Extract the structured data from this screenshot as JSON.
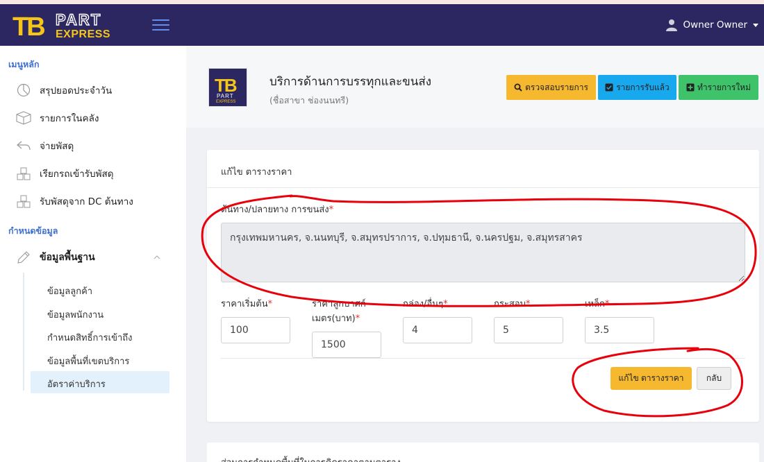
{
  "brand": {
    "logo_top": "PART",
    "logo_bottom": "EXPRESS",
    "logo_mark": "TB"
  },
  "user": {
    "name": "Owner Owner",
    "icon": "user-icon"
  },
  "sidebar": {
    "section_main": "เมนูหลัก",
    "main_items": [
      {
        "label": "สรุปยอดประจำวัน",
        "icon": "pie-chart-icon"
      },
      {
        "label": "รายการในคลัง",
        "icon": "box-icon"
      },
      {
        "label": "จ่ายพัสดุ",
        "icon": "reply-arrow-icon"
      },
      {
        "label": "เรียกรถเข้ารับพัสดุ",
        "icon": "boxes-icon"
      },
      {
        "label": "รับพัสดุจาก DC ต้นทาง",
        "icon": "boxes-icon"
      }
    ],
    "section_settings": "กำหนดข้อมูล",
    "settings_group": {
      "label": "ข้อมูลพื้นฐาน",
      "icon": "pencil-icon"
    },
    "sub_items": [
      {
        "label": "ข้อมูลลูกค้า"
      },
      {
        "label": "ข้อมูลพนักงาน"
      },
      {
        "label": "กำหนดสิทธิ์การเข้าถึง"
      },
      {
        "label": "ข้อมูลพื้นที่เขตบริการ"
      },
      {
        "label": "อัตราค่าบริการ"
      }
    ],
    "active_sub": "อัตราค่าบริการ"
  },
  "header": {
    "title": "บริการด้านการบรรทุกและขนส่ง",
    "subtitle": "(ชื่อสาขา ช่องนนทรี)",
    "buttons": [
      {
        "label": "ตรวจสอบรายการ",
        "icon": "search-icon",
        "color": "#f5b82e"
      },
      {
        "label": "รายการรับแล้ว",
        "icon": "checkbox-icon",
        "color": "#18a8ee"
      },
      {
        "label": "ทำรายการใหม่",
        "icon": "plus-square-icon",
        "color": "#3ec36a"
      }
    ]
  },
  "form": {
    "card_title": "แก้ไข ตารางราคา",
    "route_label": "ต้นทาง/ปลายทาง การขนส่ง",
    "route_value": "กรุงเทพมหานคร, จ.นนทบุรี, จ.สมุทรปราการ, จ.ปทุมธานี, จ.นครปฐม, จ.สมุทรสาคร",
    "fields": [
      {
        "label": "ราคาเริ่มต้น",
        "label_line2": "",
        "value": "100"
      },
      {
        "label": "ราคาลูกบาศก์",
        "label_line2": "เมตร(บาท)",
        "value": "1500"
      },
      {
        "label": "กล่อง/อื่นๆ",
        "label_line2": "",
        "value": "4"
      },
      {
        "label": "กระสอบ",
        "label_line2": "",
        "value": "5"
      },
      {
        "label": "เหล็ก",
        "label_line2": "",
        "value": "3.5"
      }
    ],
    "save_label": "แก้ไข ตารางราคา",
    "back_label": "กลับ"
  },
  "card2": {
    "title": "ส่วนการกำหนดพื้นที่ในการคิดราคาตามตาราง"
  },
  "colors": {
    "navbar": "#2d2761",
    "accent": "#3f6fd1",
    "logo_yellow": "#f5c518",
    "annotation": "#e8000b"
  }
}
